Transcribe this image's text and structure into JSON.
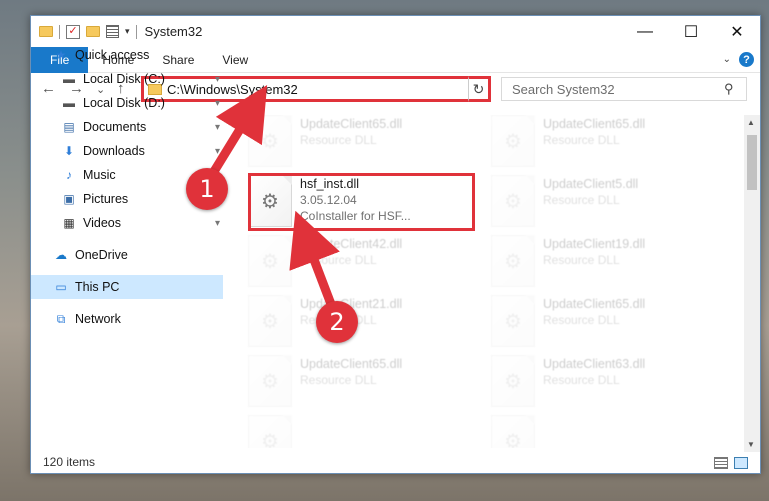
{
  "window": {
    "title": "System32",
    "qat": {
      "check": "✓",
      "drop": "▾"
    },
    "controls": {
      "minimize": "—",
      "maximize": "☐",
      "close": "✕"
    }
  },
  "ribbon": {
    "tabs": [
      "File",
      "Home",
      "Share",
      "View"
    ],
    "collapse": "⌄",
    "help": "?"
  },
  "nav": {
    "back": "←",
    "forward": "→",
    "recent": "⌄",
    "up": "↑",
    "address": "C:\\Windows\\System32",
    "address_drop": "⌄",
    "refresh": "↻",
    "search_placeholder": "Search System32",
    "search_icon": "⚲"
  },
  "sidebar": {
    "items": [
      {
        "label": "Quick access",
        "icon": "star-icon",
        "glyph": "★",
        "color": "#2f7ed8",
        "pinned": false
      },
      {
        "label": "Local Disk (C:)",
        "icon": "drive-icon",
        "glyph": "▬",
        "color": "#555",
        "pinned": true
      },
      {
        "label": "Local Disk (D:)",
        "icon": "drive-icon",
        "glyph": "▬",
        "color": "#555",
        "pinned": true
      },
      {
        "label": "Documents",
        "icon": "documents-icon",
        "glyph": "▤",
        "color": "#3c6ea8",
        "pinned": true
      },
      {
        "label": "Downloads",
        "icon": "download-icon",
        "glyph": "⬇",
        "color": "#2f7ed8",
        "pinned": true
      },
      {
        "label": "Music",
        "icon": "music-icon",
        "glyph": "♪",
        "color": "#2f7ed8",
        "pinned": true
      },
      {
        "label": "Pictures",
        "icon": "pictures-icon",
        "glyph": "▣",
        "color": "#3c6ea8",
        "pinned": true
      },
      {
        "label": "Videos",
        "icon": "video-icon",
        "glyph": "▦",
        "color": "#333",
        "pinned": true
      },
      {
        "label": "OneDrive",
        "icon": "cloud-icon",
        "glyph": "☁",
        "color": "#1979ca",
        "pinned": false
      },
      {
        "label": "This PC",
        "icon": "computer-icon",
        "glyph": "▭",
        "color": "#2f7ed8",
        "pinned": false
      },
      {
        "label": "Network",
        "icon": "network-icon",
        "glyph": "⧉",
        "color": "#2f7ed8",
        "pinned": false
      }
    ],
    "pin_glyph": "📌",
    "selected_label": "This PC"
  },
  "files": {
    "top_left": {
      "name": "UpdateClient65.dll",
      "desc": "Resource DLL"
    },
    "top_right": {
      "name": "UpdateClient65.dll",
      "desc": "Resource DLL"
    },
    "target": {
      "name": "hsf_inst.dll",
      "version": "3.05.12.04",
      "desc": "CoInstaller for HSF..."
    },
    "r2_right": {
      "name": "UpdateClient5.dll",
      "desc": "Resource DLL"
    },
    "r3_left": {
      "name": "UpdateClient42.dll",
      "desc": "Resource DLL"
    },
    "r3_right": {
      "name": "UpdateClient19.dll",
      "desc": "Resource DLL"
    },
    "r4_left": {
      "name": "UpdateClient21.dll",
      "desc": "Resource DLL"
    },
    "r4_right": {
      "name": "UpdateClient65.dll",
      "desc": "Resource DLL"
    },
    "r5_left": {
      "name": "UpdateClient65.dll",
      "desc": "Resource DLL"
    },
    "r5_right": {
      "name": "UpdateClient63.dll",
      "desc": "Resource DLL"
    }
  },
  "status": {
    "item_count": "120 items"
  },
  "annotations": {
    "step1": "1",
    "step2": "2",
    "accent": "#e0323a"
  }
}
